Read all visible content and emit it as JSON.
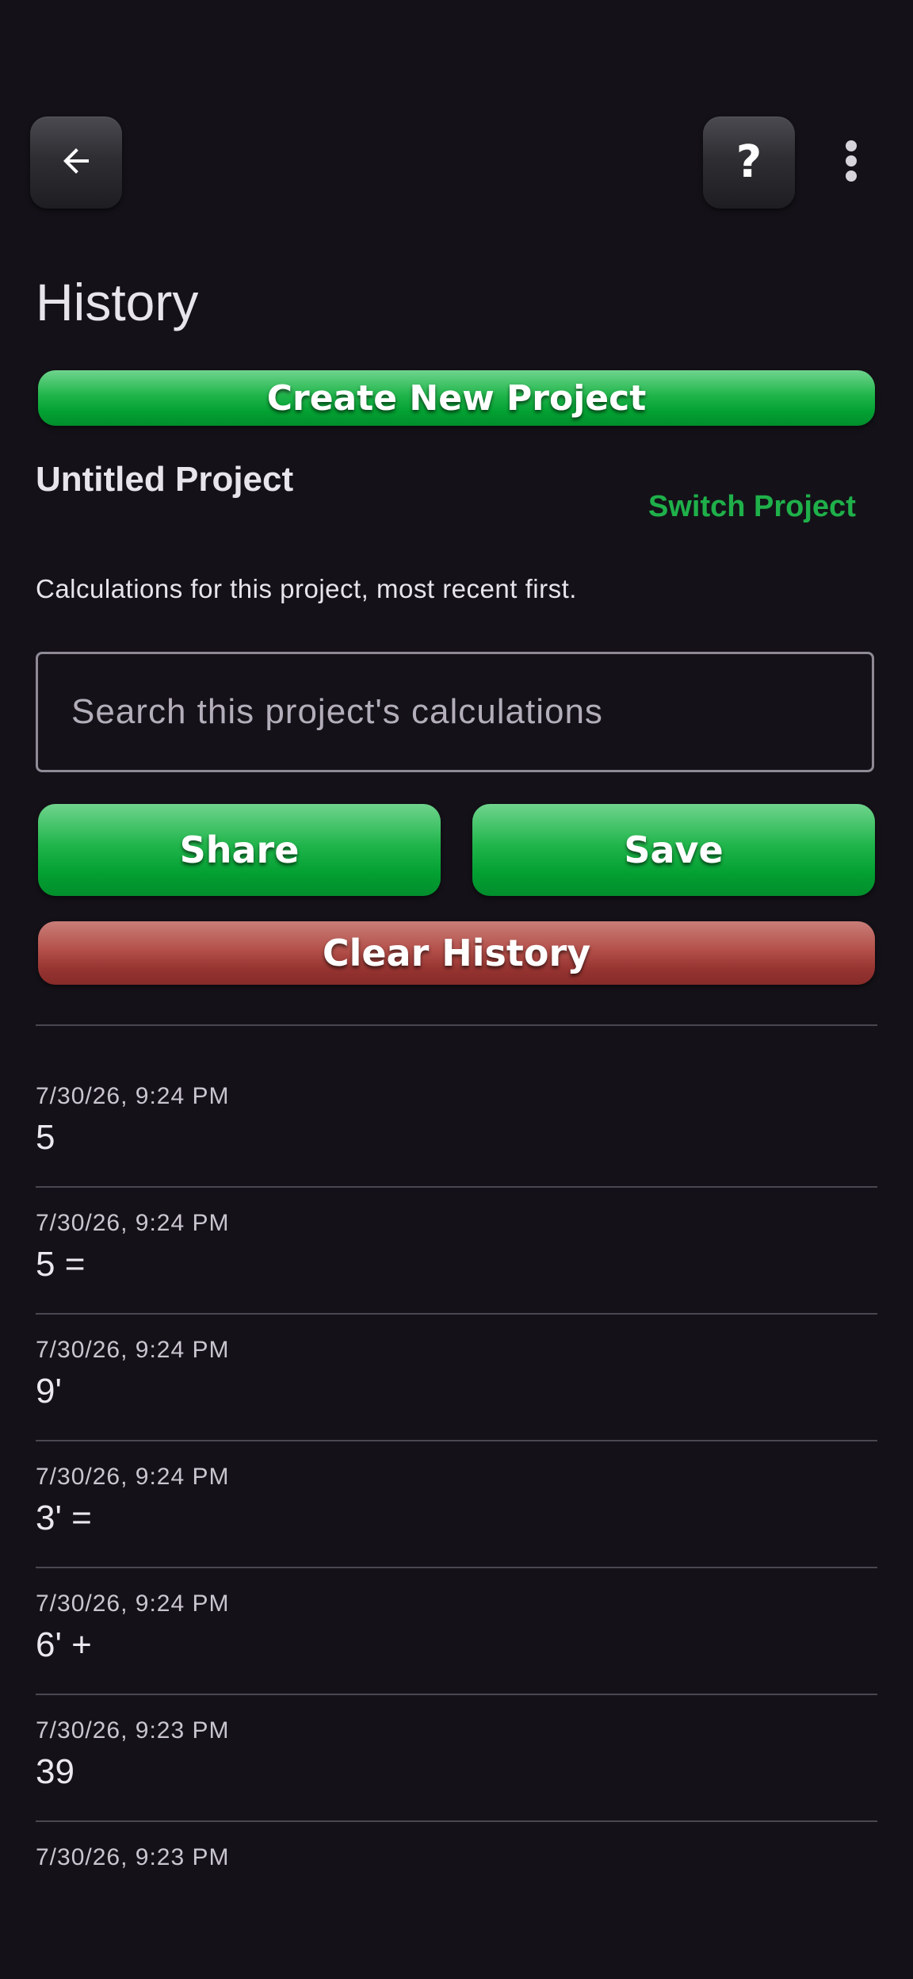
{
  "header": {
    "back_icon": "arrow-left-icon",
    "help_label": "?",
    "more_icon": "more-vertical-icon"
  },
  "page": {
    "title": "History"
  },
  "project": {
    "create_label": "Create New Project",
    "name": "Untitled Project",
    "switch_label": "Switch Project",
    "description": "Calculations for this project, most recent first."
  },
  "search": {
    "placeholder": "Search this project's calculations",
    "value": ""
  },
  "actions": {
    "share_label": "Share",
    "save_label": "Save",
    "clear_label": "Clear History"
  },
  "history": [
    {
      "timestamp": "7/30/26, 9:24 PM",
      "expression": "5"
    },
    {
      "timestamp": "7/30/26, 9:24 PM",
      "expression": "5 ="
    },
    {
      "timestamp": "7/30/26, 9:24 PM",
      "expression": "9'"
    },
    {
      "timestamp": "7/30/26, 9:24 PM",
      "expression": "3' ="
    },
    {
      "timestamp": "7/30/26, 9:24 PM",
      "expression": "6' +"
    },
    {
      "timestamp": "7/30/26, 9:23 PM",
      "expression": "39"
    },
    {
      "timestamp": "7/30/26, 9:23 PM",
      "expression": ""
    }
  ],
  "colors": {
    "background": "#141218",
    "accent_green": "#1fb04a",
    "danger_red": "#a63e3a",
    "text_primary": "#e8e4ec",
    "divider": "#4b4751"
  }
}
